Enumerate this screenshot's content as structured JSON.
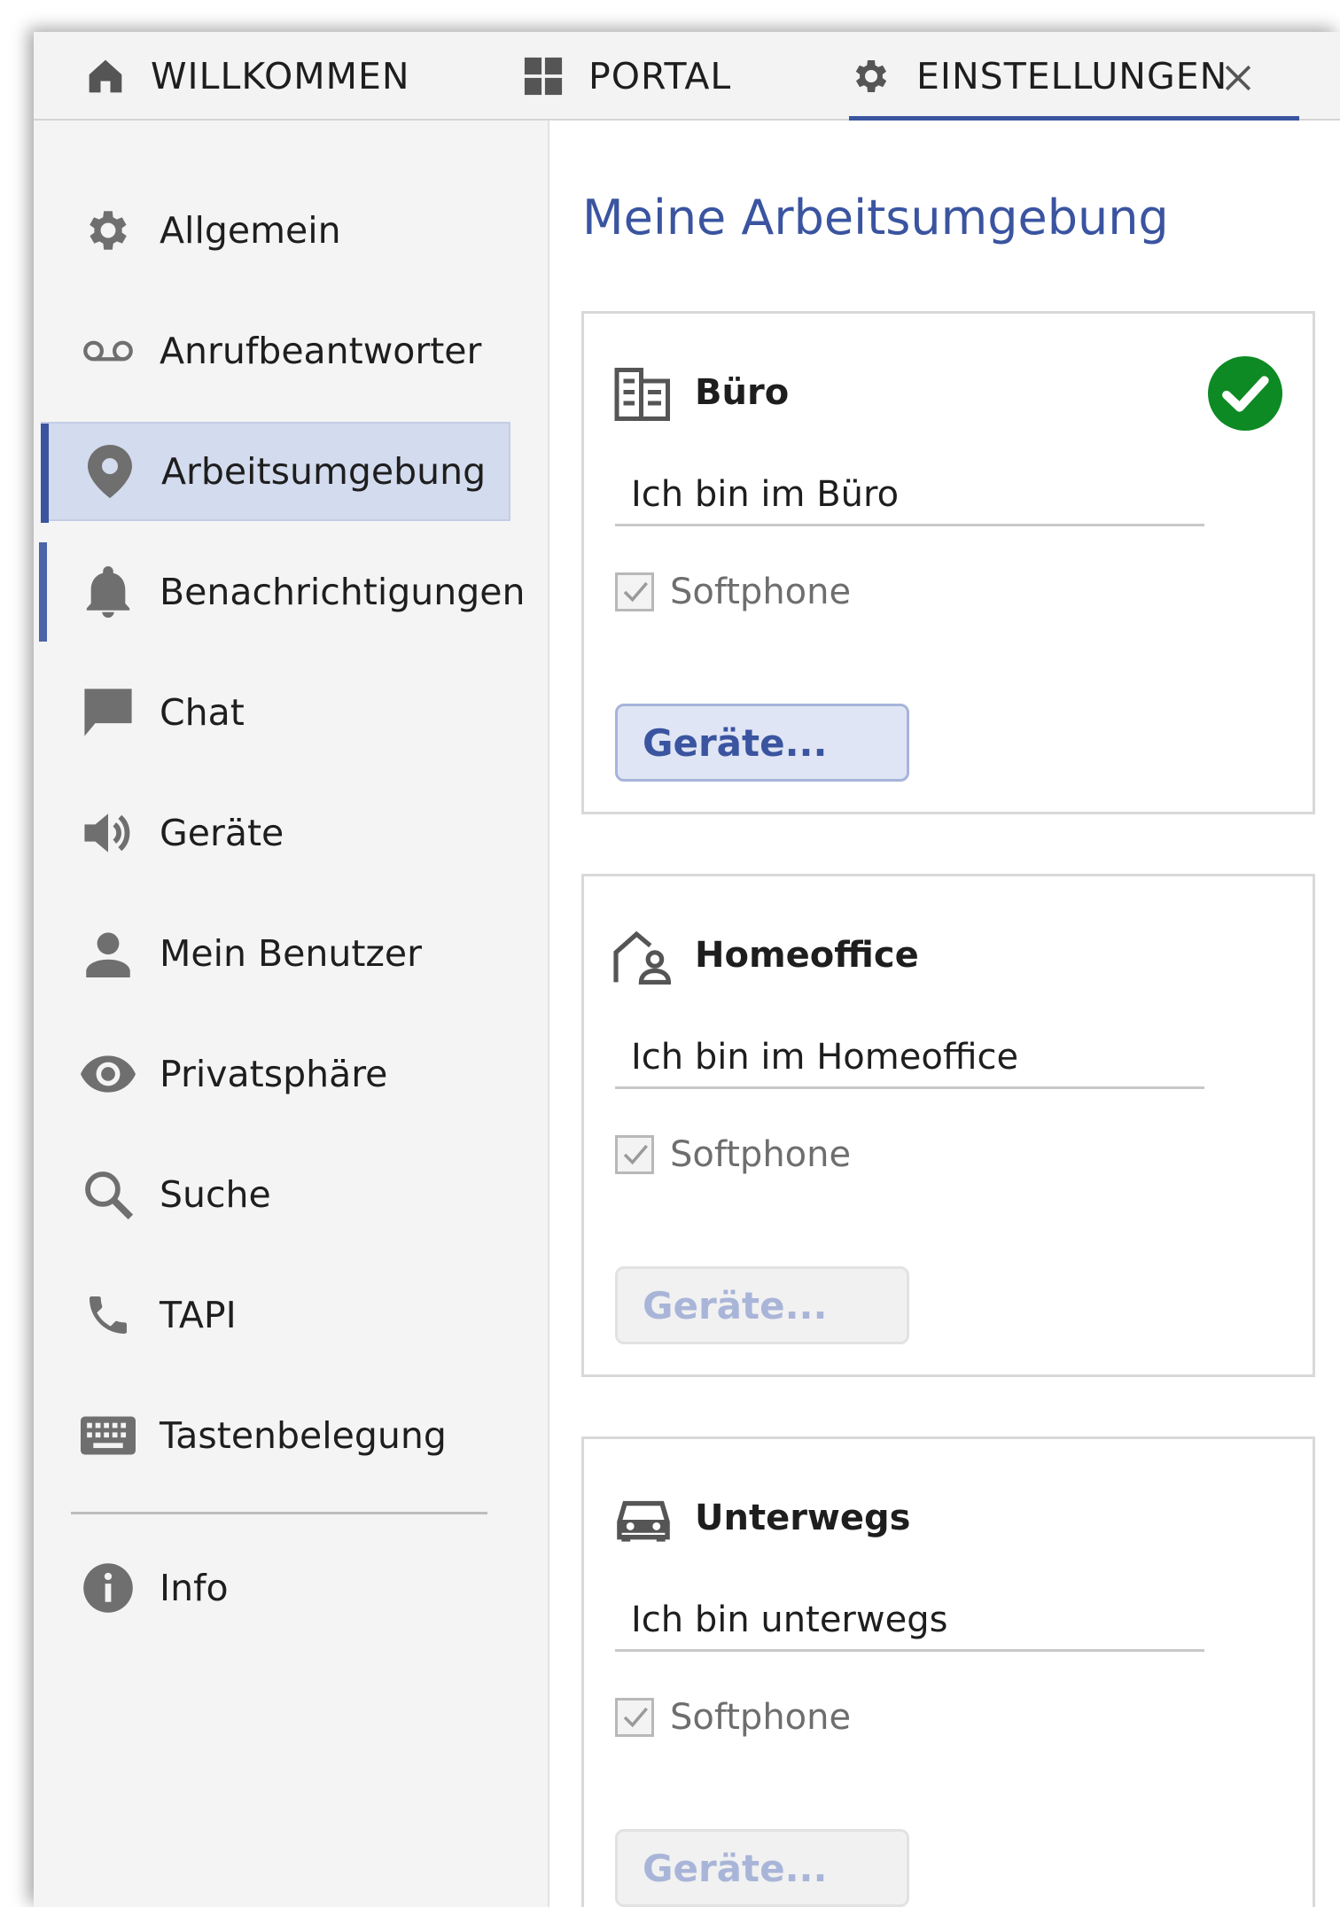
{
  "tabs": [
    {
      "label": "WILLKOMMEN",
      "icon": "home-icon"
    },
    {
      "label": "PORTAL",
      "icon": "grid-icon"
    },
    {
      "label": "EINSTELLUNGEN",
      "icon": "gear-icon",
      "active": true,
      "closable": true
    }
  ],
  "sidebar": {
    "items": [
      {
        "label": "Allgemein",
        "icon": "gear-icon"
      },
      {
        "label": "Anrufbeantworter",
        "icon": "voicemail-icon"
      },
      {
        "label": "Arbeitsumgebung",
        "icon": "location-pin-icon",
        "active": true
      },
      {
        "label": "Benachrichtigungen",
        "icon": "bell-icon"
      },
      {
        "label": "Chat",
        "icon": "chat-bubble-icon"
      },
      {
        "label": "Geräte",
        "icon": "speaker-icon"
      },
      {
        "label": "Mein Benutzer",
        "icon": "user-icon"
      },
      {
        "label": "Privatsphäre",
        "icon": "eye-icon"
      },
      {
        "label": "Suche",
        "icon": "search-icon"
      },
      {
        "label": "TAPI",
        "icon": "phone-icon"
      },
      {
        "label": "Tastenbelegung",
        "icon": "keyboard-icon"
      },
      {
        "label": "Info",
        "icon": "info-icon"
      }
    ]
  },
  "main": {
    "title": "Meine Arbeitsumgebung",
    "cards": [
      {
        "title": "Büro",
        "icon": "office-building-icon",
        "status": "selected",
        "field_value": "Ich bin im Büro",
        "checkbox_label": "Softphone",
        "checkbox_checked": true,
        "button_label": "Geräte...",
        "button_enabled": true
      },
      {
        "title": "Homeoffice",
        "icon": "home-office-icon",
        "field_value": "Ich bin im Homeoffice",
        "checkbox_label": "Softphone",
        "checkbox_checked": true,
        "button_label": "Geräte...",
        "button_enabled": false
      },
      {
        "title": "Unterwegs",
        "icon": "car-icon",
        "field_value": "Ich bin unterwegs",
        "checkbox_label": "Softphone",
        "checkbox_checked": true,
        "button_label": "Geräte...",
        "button_enabled": false
      }
    ]
  },
  "colors": {
    "accent": "#3a54a0",
    "active_nav_bg": "#d3dbee",
    "success": "#0d8a24"
  }
}
